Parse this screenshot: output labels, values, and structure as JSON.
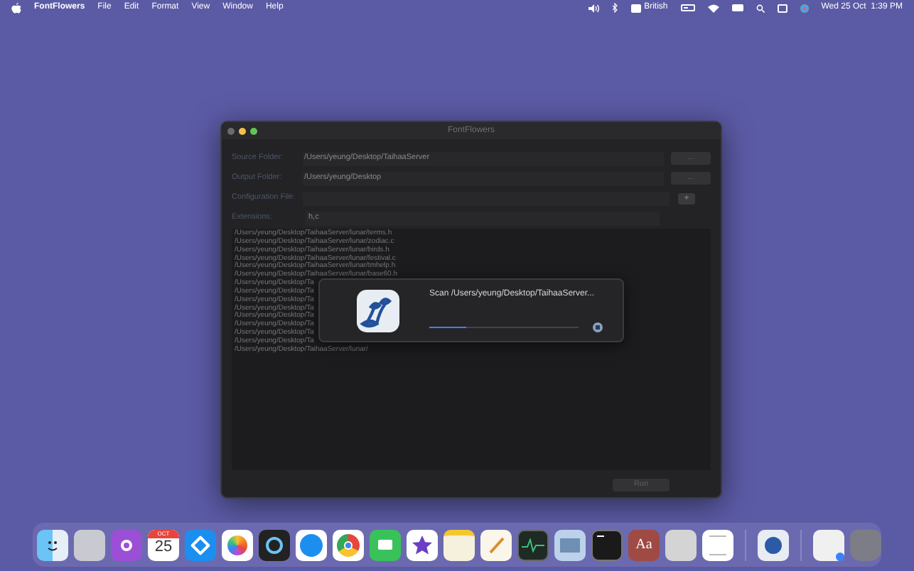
{
  "menu_bar": {
    "app_name": "FontFlowers",
    "menus": [
      "File",
      "Edit",
      "Format",
      "View",
      "Window",
      "Help"
    ],
    "input_source": "British",
    "clock": "Wed 25 Oct  1:39 PM"
  },
  "window": {
    "title": "FontFlowers",
    "fields": [
      {
        "label": "Source Folder:",
        "value": "/Users/yeung/Desktop/TaihaaServer",
        "button": "..."
      },
      {
        "label": "Output Folder:",
        "value": "/Users/yeung/Desktop",
        "button": "..."
      },
      {
        "label": "Configuration File:",
        "button": "+"
      },
      {
        "label": "Extensions:",
        "value": "h,c"
      }
    ],
    "file_list": [
      "/Users/yeung/Desktop/TaihaaServer/lunar/terms.h",
      "/Users/yeung/Desktop/TaihaaServer/lunar/zodiac.c",
      "/Users/yeung/Desktop/TaihaaServer/lunar/birds.h",
      "/Users/yeung/Desktop/TaihaaServer/lunar/festival.c",
      "/Users/yeung/Desktop/TaihaaServer/lunar/tmhelp.h",
      "/Users/yeung/Desktop/TaihaaServer/lunar/base60.h",
      "/Users/yeung/Desktop/Ta",
      "/Users/yeung/Desktop/Ta",
      "/Users/yeung/Desktop/Ta",
      "/Users/yeung/Desktop/Ta",
      "/Users/yeung/Desktop/Ta",
      "/Users/yeung/Desktop/Ta",
      "/Users/yeung/Desktop/Ta",
      "/Users/yeung/Desktop/Ta",
      "/Users/yeung/Desktop/TaihaaServer/lunar/"
    ],
    "run_button": {
      "label": "Run",
      "disabled": true
    }
  },
  "progress_dialog": {
    "message": "Scan /Users/yeung/Desktop/TaihaaServer...",
    "level": 0.25
  },
  "dock": {
    "calendar_month": "OCT",
    "calendar_day": "25",
    "dictionary_glyph": "Aa"
  }
}
